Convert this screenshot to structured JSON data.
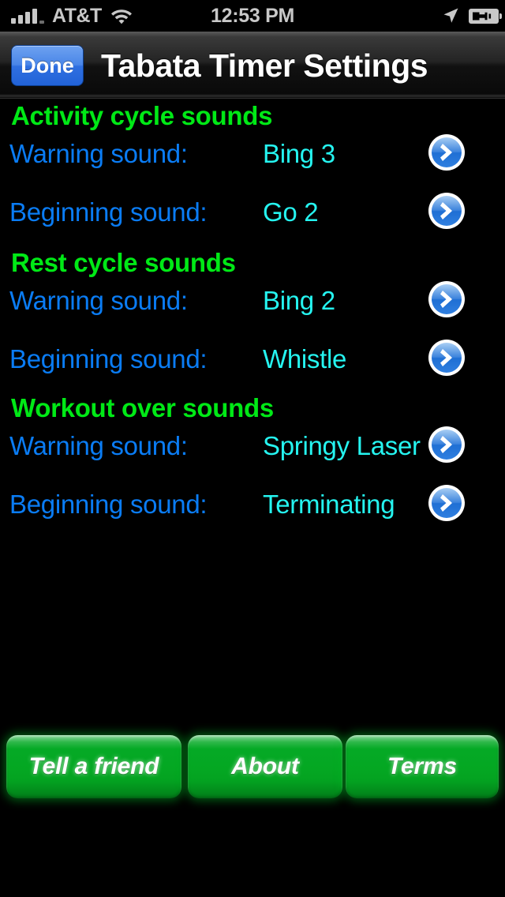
{
  "status_bar": {
    "carrier": "AT&T",
    "time": "12:53 PM",
    "signal_icon": "signal-bars-icon",
    "wifi_icon": "wifi-icon",
    "location_icon": "location-arrow-icon",
    "battery_icon": "battery-charging-icon"
  },
  "nav_bar": {
    "done_label": "Done",
    "title": "Tabata Timer Settings"
  },
  "sections": [
    {
      "header": "Activity cycle sounds",
      "rows": [
        {
          "label": "Warning sound:",
          "value": "Bing 3",
          "disclosure_icon": "chevron-right-icon"
        },
        {
          "label": "Beginning sound:",
          "value": "Go 2",
          "disclosure_icon": "chevron-right-icon"
        }
      ]
    },
    {
      "header": "Rest cycle sounds",
      "rows": [
        {
          "label": "Warning sound:",
          "value": "Bing 2",
          "disclosure_icon": "chevron-right-icon"
        },
        {
          "label": "Beginning sound:",
          "value": "Whistle",
          "disclosure_icon": "chevron-right-icon"
        }
      ]
    },
    {
      "header": "Workout over sounds",
      "rows": [
        {
          "label": "Warning sound:",
          "value": "Springy Laser",
          "disclosure_icon": "chevron-right-icon"
        },
        {
          "label": "Beginning sound:",
          "value": "Terminating",
          "disclosure_icon": "chevron-right-icon"
        }
      ]
    }
  ],
  "bottom_buttons": [
    {
      "label": "Tell a friend"
    },
    {
      "label": "About"
    },
    {
      "label": "Terms"
    }
  ],
  "colors": {
    "background": "#000000",
    "section_header": "#00e916",
    "row_label": "#0a7cf4",
    "row_value": "#25f4f0",
    "accent_button": "#04a722",
    "disclosure": "#2f7fe0",
    "done_button": "#2f6fe0"
  }
}
